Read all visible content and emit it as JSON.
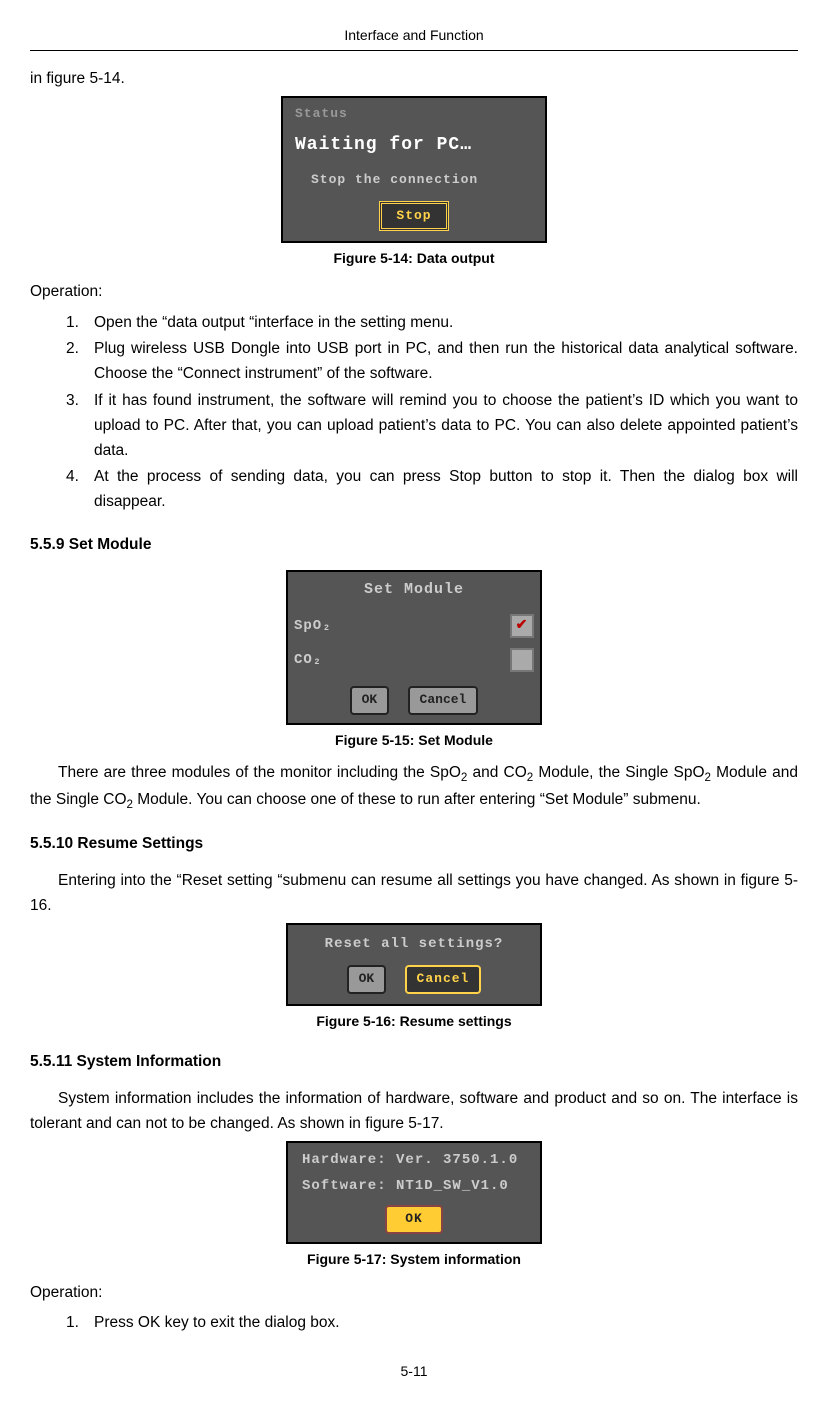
{
  "header": {
    "title": "Interface and Function"
  },
  "intro": "in figure 5-14.",
  "fig514": {
    "status": "Status",
    "waiting": "Waiting for PC…",
    "stopconn": "Stop the connection",
    "stop_btn": "Stop",
    "caption": "Figure 5-14: Data output"
  },
  "operation1": {
    "label": "Operation:",
    "items": [
      {
        "n": "1.",
        "t": "Open the “data output “interface in the setting menu."
      },
      {
        "n": "2.",
        "t": "Plug wireless USB Dongle into USB port in PC, and then run the historical data analytical software. Choose the “Connect instrument” of the software."
      },
      {
        "n": "3.",
        "t": "If it has found instrument, the software will remind you to choose the patient’s ID which you want to upload to PC. After that, you can upload patient’s data to PC. You can also delete appointed patient’s data."
      },
      {
        "n": "4.",
        "t": "At the process of sending data, you can press Stop button to stop it. Then the dialog box will disappear."
      }
    ]
  },
  "sec559": {
    "head": "5.5.9 Set Module"
  },
  "fig515": {
    "title": "Set Module",
    "row1": "SpO₂",
    "row2": "CO₂",
    "ok": "OK",
    "cancel": "Cancel",
    "caption": "Figure 5-15: Set Module"
  },
  "para559_pre": "There are three modules of the monitor including the SpO",
  "para559_mid1": " and CO",
  "para559_mid2": " Module, the Single SpO",
  "para559_mid3": " Module and the Single CO",
  "para559_post": " Module. You can choose one of these to run after entering “Set Module” submenu.",
  "sub2": "2",
  "sec5510": {
    "head": "5.5.10 Resume Settings",
    "para": "Entering into the “Reset setting “submenu can resume all settings you have changed. As shown in figure 5-16."
  },
  "fig516": {
    "q": "Reset all settings?",
    "ok": "OK",
    "cancel": "Cancel",
    "caption": "Figure 5-16: Resume settings"
  },
  "sec5511": {
    "head": "5.5.11 System Information",
    "para": "System information includes the information of hardware, software and product and so on. The interface is tolerant and can not to be changed. As shown in figure 5-17."
  },
  "fig517": {
    "hw": "Hardware: Ver. 3750.1.0",
    "sw": "Software: NT1D_SW_V1.0",
    "ok": "OK",
    "caption": "Figure 5-17: System information"
  },
  "operation2": {
    "label": "Operation:",
    "items": [
      {
        "n": "1.",
        "t": "Press OK key to exit the dialog box."
      }
    ]
  },
  "footer": {
    "page": "5-11"
  }
}
